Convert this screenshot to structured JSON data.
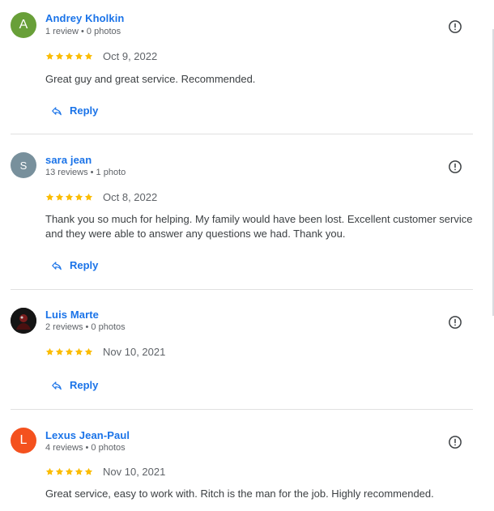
{
  "reviews": [
    {
      "author": "Andrey Kholkin",
      "avatar_letter": "A",
      "avatar_color": "#689f38",
      "meta": "1 review • 0 photos",
      "rating": 5,
      "date": "Oct 9, 2022",
      "text": "Great guy and great service. Recommended.",
      "reply_label": "Reply"
    },
    {
      "author": "sara jean",
      "avatar_letter": "S",
      "avatar_color": "#78909c",
      "meta": "13 reviews • 1 photo",
      "rating": 5,
      "date": "Oct 8, 2022",
      "text": "Thank you so much for helping. My family would have been lost. Excellent customer service and they were able to answer any questions we had. Thank you.",
      "reply_label": "Reply"
    },
    {
      "author": "Luis Marte",
      "avatar_letter": "",
      "avatar_color": "#1b1b1b",
      "meta": "2 reviews • 0 photos",
      "rating": 5,
      "date": "Nov 10, 2021",
      "text": "",
      "reply_label": "Reply"
    },
    {
      "author": "Lexus Jean-Paul",
      "avatar_letter": "L",
      "avatar_color": "#f4511e",
      "meta": "4 reviews • 0 photos",
      "rating": 5,
      "date": "Nov 10, 2021",
      "text": "Great service, easy to work with. Ritch is the man for the job. Highly recommended.",
      "reply_label": ""
    }
  ],
  "icons": {
    "flag": "report-flag-icon",
    "star": "star-icon",
    "reply": "reply-arrow-icon"
  },
  "colors": {
    "link": "#1a73e8",
    "star": "#fbbc04",
    "muted": "#5f6368"
  }
}
